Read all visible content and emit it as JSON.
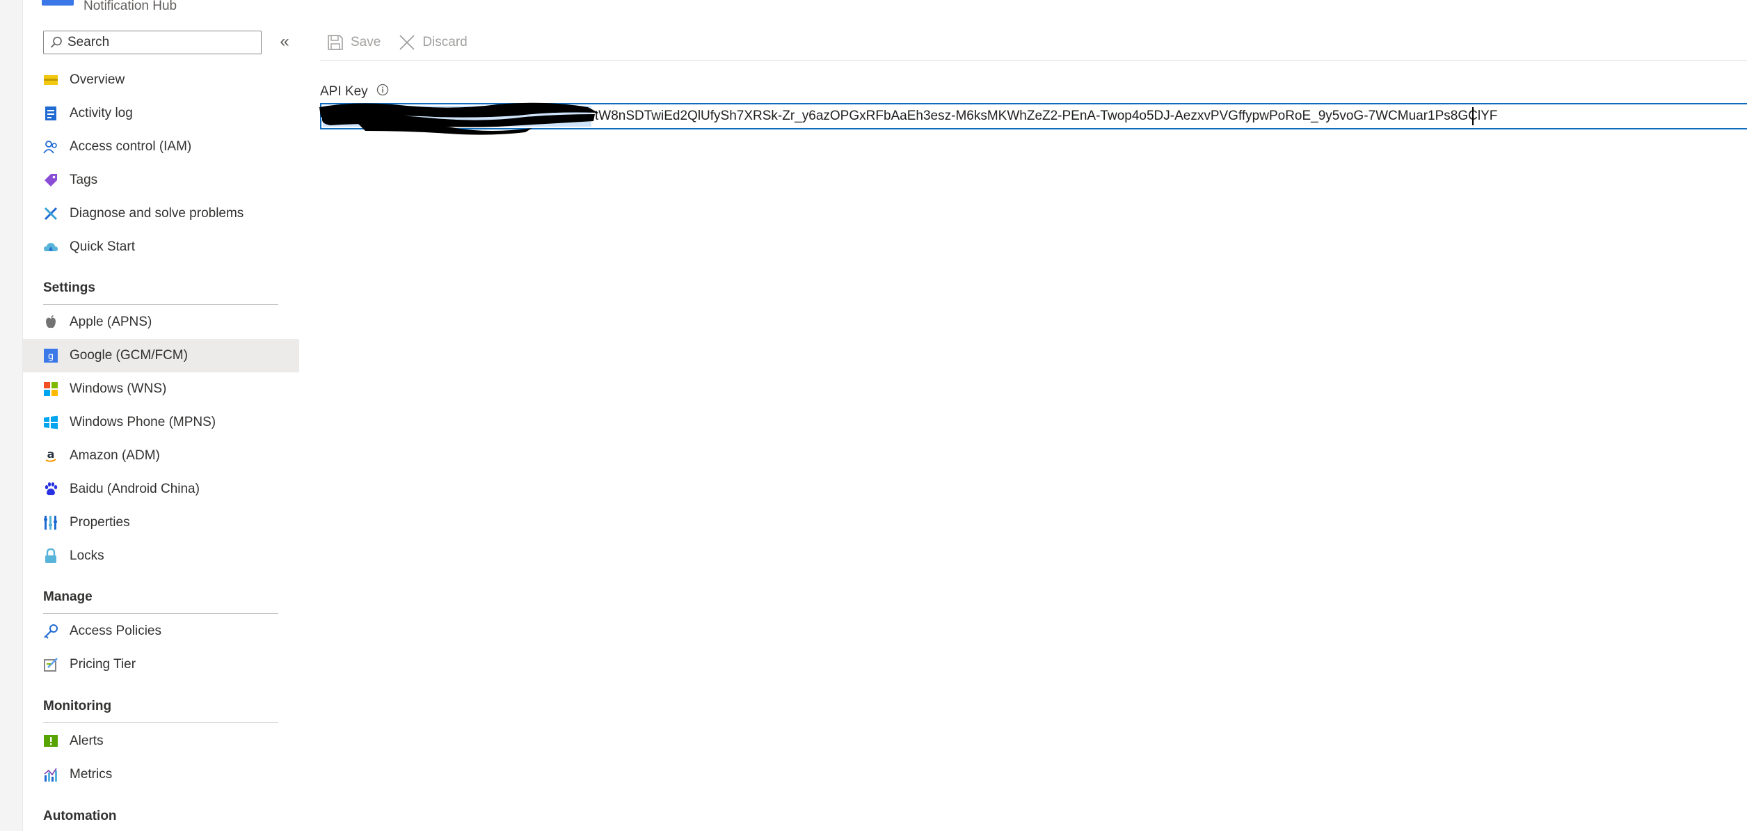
{
  "header": {
    "resource_type": "Notification Hub"
  },
  "search": {
    "placeholder": "Search"
  },
  "nav": {
    "top_items": [
      {
        "label": "Overview",
        "icon": "overview-icon"
      },
      {
        "label": "Activity log",
        "icon": "activity-log-icon"
      },
      {
        "label": "Access control (IAM)",
        "icon": "people-icon"
      },
      {
        "label": "Tags",
        "icon": "tag-icon"
      },
      {
        "label": "Diagnose and solve problems",
        "icon": "wrench-icon"
      },
      {
        "label": "Quick Start",
        "icon": "cloud-icon"
      }
    ],
    "sections": [
      {
        "title": "Settings",
        "items": [
          {
            "label": "Apple (APNS)",
            "icon": "apple-icon"
          },
          {
            "label": "Google (GCM/FCM)",
            "icon": "google-icon",
            "selected": true
          },
          {
            "label": "Windows (WNS)",
            "icon": "windows-icon"
          },
          {
            "label": "Windows Phone (MPNS)",
            "icon": "windows-phone-icon"
          },
          {
            "label": "Amazon (ADM)",
            "icon": "amazon-icon"
          },
          {
            "label": "Baidu (Android China)",
            "icon": "paw-icon"
          },
          {
            "label": "Properties",
            "icon": "properties-icon"
          },
          {
            "label": "Locks",
            "icon": "lock-icon"
          }
        ]
      },
      {
        "title": "Manage",
        "items": [
          {
            "label": "Access Policies",
            "icon": "key-icon"
          },
          {
            "label": "Pricing Tier",
            "icon": "pricing-tier-icon"
          }
        ]
      },
      {
        "title": "Monitoring",
        "items": [
          {
            "label": "Alerts",
            "icon": "alert-icon"
          },
          {
            "label": "Metrics",
            "icon": "metrics-icon"
          }
        ]
      },
      {
        "title": "Automation",
        "items": []
      }
    ]
  },
  "toolbar": {
    "save_label": "Save",
    "discard_label": "Discard"
  },
  "form": {
    "api_key_label": "API Key",
    "api_key_value": "tW8nSDTwiEd2QlUfySh7XRSk-Zr_y6azOPGxRFbAaEh3esz-M6ksMKWhZeZ2-PEnA-Twop4o5DJ-AezxvPVGffypwPoRoE_9y5voG-7WCMuar1Ps8GClYF"
  },
  "colors": {
    "accent": "#0f6cbd",
    "selected_bg": "#edebe9",
    "disabled_text": "#a19f9d"
  }
}
